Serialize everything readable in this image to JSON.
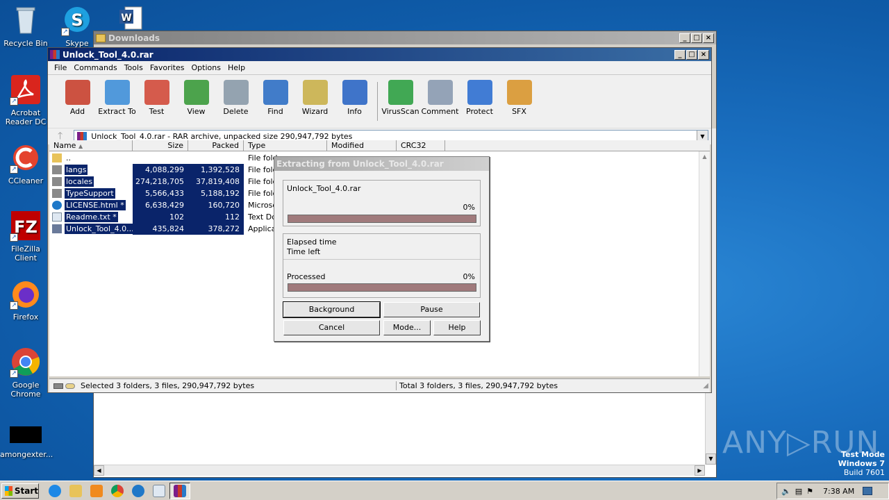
{
  "desktop": {
    "icons": [
      {
        "label": "Recycle Bin"
      },
      {
        "label": "Skype"
      },
      {
        "label": "Acrobat Reader DC"
      },
      {
        "label": "CCleaner"
      },
      {
        "label": "FileZilla Client"
      },
      {
        "label": "Firefox"
      },
      {
        "label": "Google Chrome"
      },
      {
        "label": "amongexter..."
      }
    ],
    "watermark": "ANY▷RUN",
    "test_mode": {
      "line1": "Test Mode",
      "line2": "Windows 7",
      "line3": "Build 7601"
    }
  },
  "explorer": {
    "title": "Downloads"
  },
  "winrar": {
    "title": "Unlock_Tool_4.0.rar",
    "menu": [
      "File",
      "Commands",
      "Tools",
      "Favorites",
      "Options",
      "Help"
    ],
    "toolbar": [
      {
        "label": "Add",
        "icon": "add-archive-icon",
        "color": "#c8402e"
      },
      {
        "label": "Extract To",
        "icon": "extract-folder-icon",
        "color": "#3f8fd8"
      },
      {
        "label": "Test",
        "icon": "test-checklist-icon",
        "color": "#d24a3a"
      },
      {
        "label": "View",
        "icon": "view-book-icon",
        "color": "#3a9a3a"
      },
      {
        "label": "Delete",
        "icon": "trash-icon",
        "color": "#8a9aa8"
      },
      {
        "label": "Find",
        "icon": "magnifier-icon",
        "color": "#2d6fc4"
      },
      {
        "label": "Wizard",
        "icon": "wand-icon",
        "color": "#c9b04a"
      },
      {
        "label": "Info",
        "icon": "info-icon",
        "color": "#2b66c4"
      },
      {
        "label": "VirusScan",
        "icon": "virus-bug-icon",
        "color": "#2ea043"
      },
      {
        "label": "Comment",
        "icon": "comment-icon",
        "color": "#8a9ab0"
      },
      {
        "label": "Protect",
        "icon": "shield-icon",
        "color": "#2d6fd0"
      },
      {
        "label": "SFX",
        "icon": "sfx-box-icon",
        "color": "#d8962e"
      }
    ],
    "address": "Unlock_Tool_4.0.rar - RAR archive, unpacked size 290,947,792 bytes",
    "columns": [
      "Name",
      "Size",
      "Packed",
      "Type",
      "Modified",
      "CRC32"
    ],
    "rows": [
      {
        "name": "..",
        "size": "",
        "packed": "",
        "type": "File fold",
        "selected": false
      },
      {
        "name": "langs",
        "size": "4,088,299",
        "packed": "1,392,528",
        "type": "File fold",
        "selected": true
      },
      {
        "name": "locales",
        "size": "274,218,705",
        "packed": "37,819,408",
        "type": "File fold",
        "selected": true
      },
      {
        "name": "TypeSupport",
        "size": "5,566,433",
        "packed": "5,188,192",
        "type": "File fold",
        "selected": true
      },
      {
        "name": "LICENSE.html *",
        "size": "6,638,429",
        "packed": "160,720",
        "type": "Microso",
        "selected": true
      },
      {
        "name": "Readme.txt *",
        "size": "102",
        "packed": "112",
        "type": "Text Do",
        "selected": true
      },
      {
        "name": "Unlock_Tool_4.0....",
        "size": "435,824",
        "packed": "378,272",
        "type": "Applicat",
        "selected": true
      }
    ],
    "status_left": "Selected 3 folders, 3 files, 290,947,792 bytes",
    "status_right": "Total 3 folders, 3 files, 290,947,792 bytes"
  },
  "extract_dialog": {
    "title": "Extracting from Unlock_Tool_4.0.rar",
    "file_name": "Unlock_Tool_4.0.rar",
    "file_percent": "0%",
    "elapsed_label": "Elapsed time",
    "left_label": "Time left",
    "processed_label": "Processed",
    "processed_percent": "0%",
    "buttons": {
      "background": "Background",
      "pause": "Pause",
      "cancel": "Cancel",
      "mode": "Mode...",
      "help": "Help"
    }
  },
  "taskbar": {
    "start": "Start",
    "clock": "7:38 AM"
  }
}
